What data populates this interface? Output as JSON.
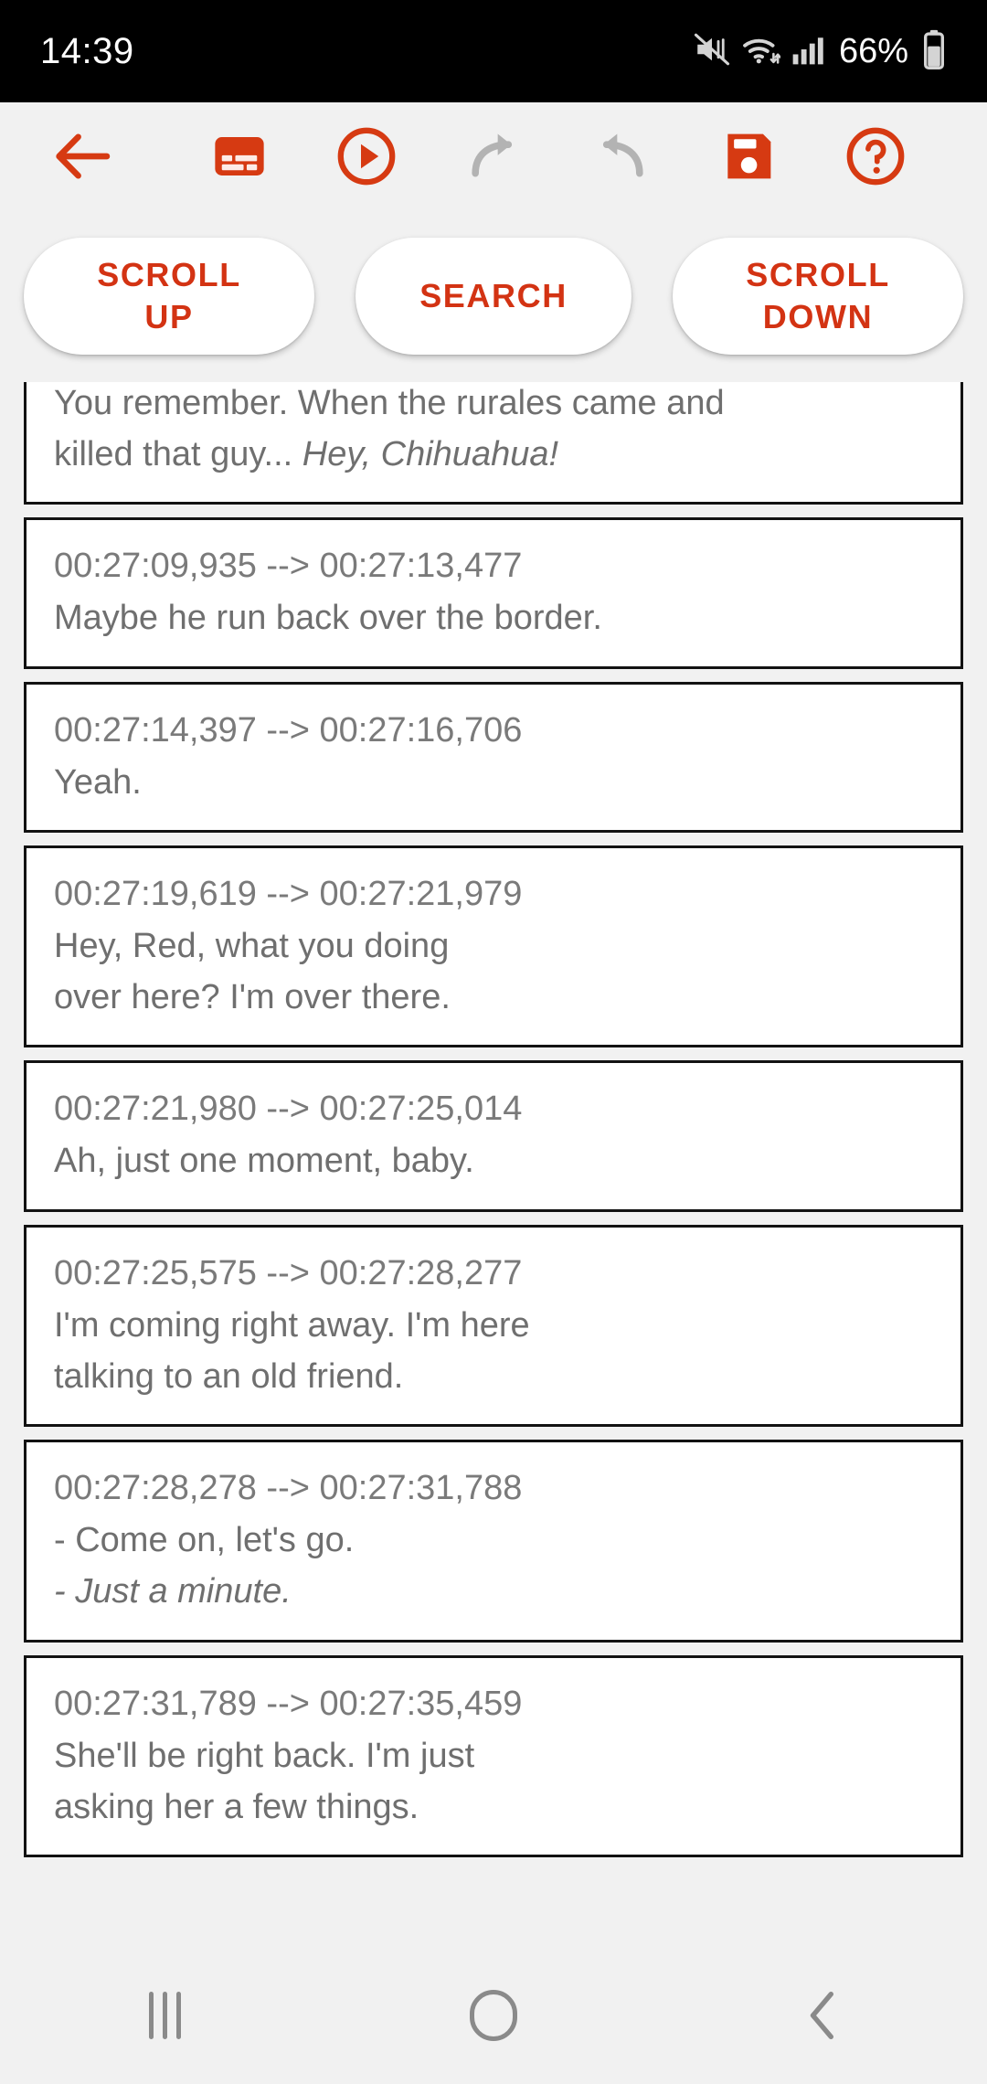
{
  "statusbar": {
    "clock": "14:39",
    "battery_percent": "66%",
    "icons": [
      "mute-icon",
      "wifi-icon",
      "cellular-signal-icon",
      "battery-icon"
    ]
  },
  "toolbar": {
    "items": [
      {
        "name": "back-arrow-icon",
        "label": "Back",
        "color": "#d63a12",
        "enabled": true
      },
      {
        "name": "subtitles-icon",
        "label": "Subtitles",
        "color": "#d63a12",
        "enabled": true
      },
      {
        "name": "play-circle-icon",
        "label": "Play",
        "color": "#d63a12",
        "enabled": true
      },
      {
        "name": "redo-icon",
        "label": "Redo",
        "color": "#b3b3b3",
        "enabled": false
      },
      {
        "name": "undo-icon",
        "label": "Undo",
        "color": "#b3b3b3",
        "enabled": false
      },
      {
        "name": "save-floppy-icon",
        "label": "Save",
        "color": "#d63a12",
        "enabled": true
      },
      {
        "name": "help-circle-icon",
        "label": "Help",
        "color": "#d63a12",
        "enabled": true
      }
    ]
  },
  "actions": {
    "scroll_up": "SCROLL\nUP",
    "scroll_up_line1": "SCROLL",
    "scroll_up_line2": "UP",
    "search": "SEARCH",
    "scroll_down_line1": "SCROLL",
    "scroll_down_line2": "DOWN"
  },
  "colors": {
    "accent": "#d63a12",
    "accent_text": "#d33313",
    "background": "#f1f1f1",
    "card_background": "#ffffff",
    "card_border": "#121212",
    "subtitle_text": "#6f6f6f",
    "time_text": "#7a7a7a",
    "disabled_icon": "#b3b3b3"
  },
  "subtitles": [
    {
      "time": "",
      "partial_top": true,
      "lines": [
        {
          "text": "You remember. When the rurales came and",
          "italic": false
        },
        {
          "text": "killed that guy... ",
          "italic": false,
          "tail_italic": "Hey, Chihuahua!"
        }
      ]
    },
    {
      "time": "00:27:09,935 --> 00:27:13,477",
      "lines": [
        {
          "text": "Maybe he run back over the border.",
          "italic": false
        }
      ]
    },
    {
      "time": "00:27:14,397 --> 00:27:16,706",
      "lines": [
        {
          "text": "Yeah.",
          "italic": false
        }
      ]
    },
    {
      "time": "00:27:19,619 --> 00:27:21,979",
      "lines": [
        {
          "text": "Hey, Red, what you doing",
          "italic": false
        },
        {
          "text": "over here? I'm over there.",
          "italic": false
        }
      ]
    },
    {
      "time": "00:27:21,980 --> 00:27:25,014",
      "lines": [
        {
          "text": "Ah, just one moment, baby.",
          "italic": false
        }
      ]
    },
    {
      "time": "00:27:25,575 --> 00:27:28,277",
      "lines": [
        {
          "text": "I'm coming right away. I'm here",
          "italic": false
        },
        {
          "text": "talking to an old friend.",
          "italic": false
        }
      ]
    },
    {
      "time": "00:27:28,278 --> 00:27:31,788",
      "lines": [
        {
          "text": "- Come on, let's go.",
          "italic": false
        },
        {
          "text": "- Just a minute.",
          "italic": true
        }
      ]
    },
    {
      "time": "00:27:31,789 --> 00:27:35,459",
      "lines": [
        {
          "text": "She'll be right back. I'm just",
          "italic": false
        },
        {
          "text": "asking her a few things.",
          "italic": false
        }
      ]
    }
  ],
  "navbar": {
    "items": [
      {
        "name": "recents-icon",
        "label": "Recents"
      },
      {
        "name": "home-icon",
        "label": "Home"
      },
      {
        "name": "back-icon",
        "label": "Back"
      }
    ]
  }
}
